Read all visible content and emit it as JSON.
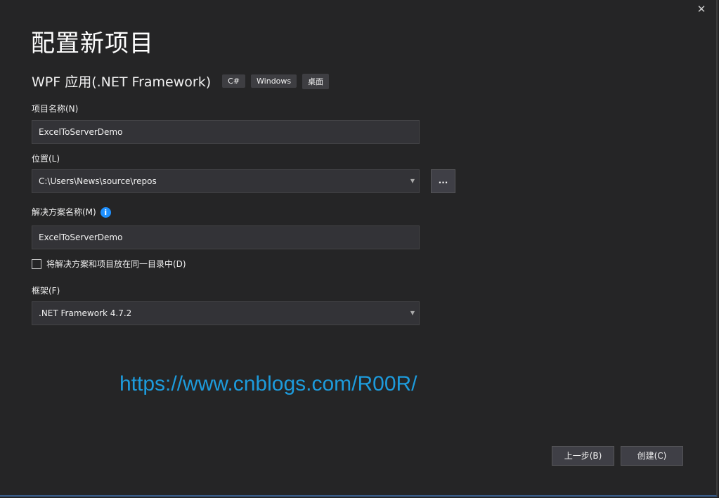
{
  "dialog": {
    "title": "配置新项目",
    "close_glyph": "✕"
  },
  "template": {
    "name": "WPF 应用(.NET Framework)",
    "tags": [
      "C#",
      "Windows",
      "桌面"
    ]
  },
  "project_name": {
    "label": "项目名称(N)",
    "value": "ExcelToServerDemo"
  },
  "location": {
    "label": "位置(L)",
    "value": "C:\\Users\\News\\source\\repos",
    "browse_label": "..."
  },
  "solution_name": {
    "label": "解决方案名称(M)",
    "info_glyph": "i",
    "value": "ExcelToServerDemo"
  },
  "same_dir": {
    "label": "将解决方案和项目放在同一目录中(D)",
    "checked": false
  },
  "framework": {
    "label": "框架(F)",
    "value": ".NET Framework 4.7.2"
  },
  "watermark": "https://www.cnblogs.com/R00R/",
  "footer": {
    "back_label": "上一步(B)",
    "create_label": "创建(C)"
  },
  "colors": {
    "background": "#252526",
    "field": "#333337",
    "accent": "#1e90ff",
    "watermark": "#1d9bdc"
  },
  "icons": {
    "close": "close-icon",
    "info": "info-icon",
    "dropdown": "chevron-down-icon"
  }
}
